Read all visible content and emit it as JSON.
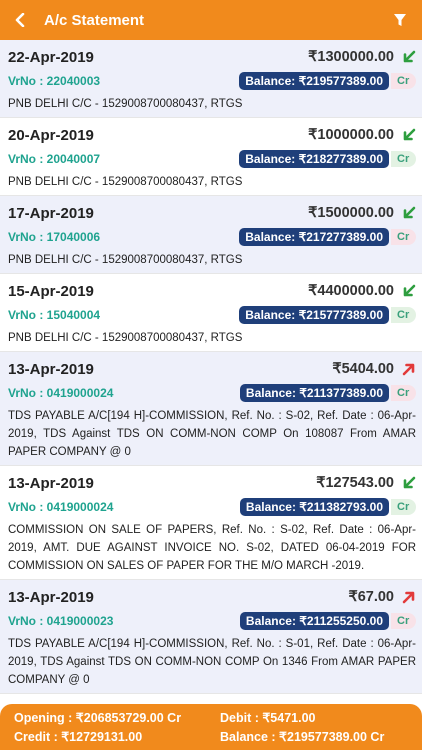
{
  "header": {
    "title": "A/c Statement"
  },
  "icons": {
    "back": "chevron-left-icon",
    "filter": "filter-icon",
    "in": "arrow-down-left-icon",
    "out": "arrow-up-right-icon"
  },
  "colors": {
    "primary": "#f18a1c",
    "balance_bg": "#1f3f7a",
    "vr": "#1fa38f",
    "in_arrow": "#2e9e3f",
    "out_arrow": "#e23a3a"
  },
  "entries": [
    {
      "date": "22-Apr-2019",
      "amount": "₹1300000.00",
      "direction": "in",
      "vrno": "VrNo : 22040003",
      "balance": "Balance: ₹219577389.00",
      "type": "Cr",
      "desc": "PNB DELHI C/C - 1529008700080437, RTGS"
    },
    {
      "date": "20-Apr-2019",
      "amount": "₹1000000.00",
      "direction": "in",
      "vrno": "VrNo : 20040007",
      "balance": "Balance: ₹218277389.00",
      "type": "Cr",
      "desc": "PNB DELHI C/C - 1529008700080437, RTGS"
    },
    {
      "date": "17-Apr-2019",
      "amount": "₹1500000.00",
      "direction": "in",
      "vrno": "VrNo : 17040006",
      "balance": "Balance: ₹217277389.00",
      "type": "Cr",
      "desc": "PNB DELHI C/C - 1529008700080437, RTGS"
    },
    {
      "date": "15-Apr-2019",
      "amount": "₹4400000.00",
      "direction": "in",
      "vrno": "VrNo : 15040004",
      "balance": "Balance: ₹215777389.00",
      "type": "Cr",
      "desc": "PNB DELHI C/C - 1529008700080437, RTGS"
    },
    {
      "date": "13-Apr-2019",
      "amount": "₹5404.00",
      "direction": "out",
      "vrno": "VrNo : 0419000024",
      "balance": "Balance: ₹211377389.00",
      "type": "Cr",
      "desc": "TDS PAYABLE A/C[194 H]-COMMISSION, Ref. No. : S-02, Ref. Date : 06-Apr-2019, TDS Against TDS ON COMM-NON COMP On 108087 From AMAR PAPER COMPANY @ 0"
    },
    {
      "date": "13-Apr-2019",
      "amount": "₹127543.00",
      "direction": "in",
      "vrno": "VrNo : 0419000024",
      "balance": "Balance: ₹211382793.00",
      "type": "Cr",
      "desc": "COMMISSION ON SALE OF PAPERS, Ref. No. : S-02, Ref. Date : 06-Apr-2019, AMT. DUE AGAINST INVOICE NO. S-02, DATED 06-04-2019 FOR COMMISSION ON SALES OF PAPER FOR THE M/O MARCH -2019."
    },
    {
      "date": "13-Apr-2019",
      "amount": "₹67.00",
      "direction": "out",
      "vrno": "VrNo : 0419000023",
      "balance": "Balance: ₹211255250.00",
      "type": "Cr",
      "desc": "TDS PAYABLE A/C[194 H]-COMMISSION, Ref. No. : S-01, Ref. Date : 06-Apr-2019, TDS Against TDS ON COMM-NON COMP On 1346 From AMAR PAPER COMPANY @ 0"
    }
  ],
  "footer": {
    "opening": "Opening : ₹206853729.00 Cr",
    "debit": "Debit : ₹5471.00",
    "credit": "Credit : ₹12729131.00",
    "balance": "Balance : ₹219577389.00 Cr"
  }
}
